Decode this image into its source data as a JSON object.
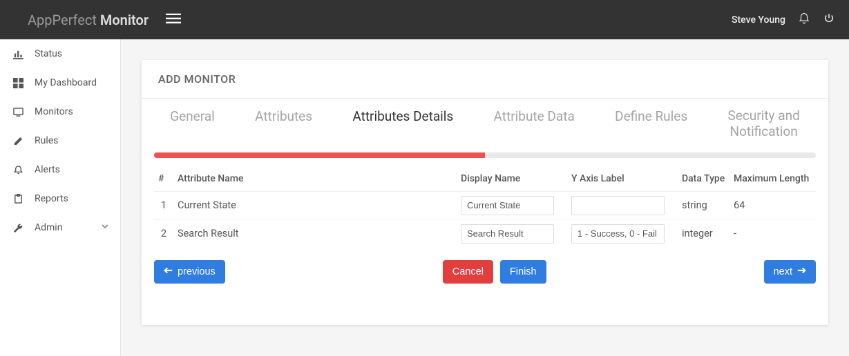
{
  "brand": {
    "light": "AppPerfect",
    "bold": "Monitor"
  },
  "user": {
    "name": "Steve Young"
  },
  "sidebar": {
    "items": [
      {
        "label": "Status"
      },
      {
        "label": "My Dashboard"
      },
      {
        "label": "Monitors"
      },
      {
        "label": "Rules"
      },
      {
        "label": "Alerts"
      },
      {
        "label": "Reports"
      },
      {
        "label": "Admin"
      }
    ]
  },
  "main": {
    "title": "ADD MONITOR",
    "steps": [
      "General",
      "Attributes",
      "Attributes Details",
      "Attribute Data",
      "Define Rules",
      "Security and Notification"
    ],
    "progress_pct": 50,
    "columns": {
      "num": "#",
      "name": "Attribute Name",
      "display": "Display Name",
      "ylabel": "Y Axis Label",
      "type": "Data Type",
      "max": "Maximum Length"
    },
    "rows": [
      {
        "num": "1",
        "name": "Current State",
        "display": "Current State",
        "ylabel": "",
        "type": "string",
        "max": "64"
      },
      {
        "num": "2",
        "name": "Search Result",
        "display": "Search Result",
        "ylabel": "1 - Success, 0 - Fail",
        "type": "integer",
        "max": "-"
      }
    ],
    "buttons": {
      "previous": "previous",
      "cancel": "Cancel",
      "finish": "Finish",
      "next": "next"
    }
  }
}
